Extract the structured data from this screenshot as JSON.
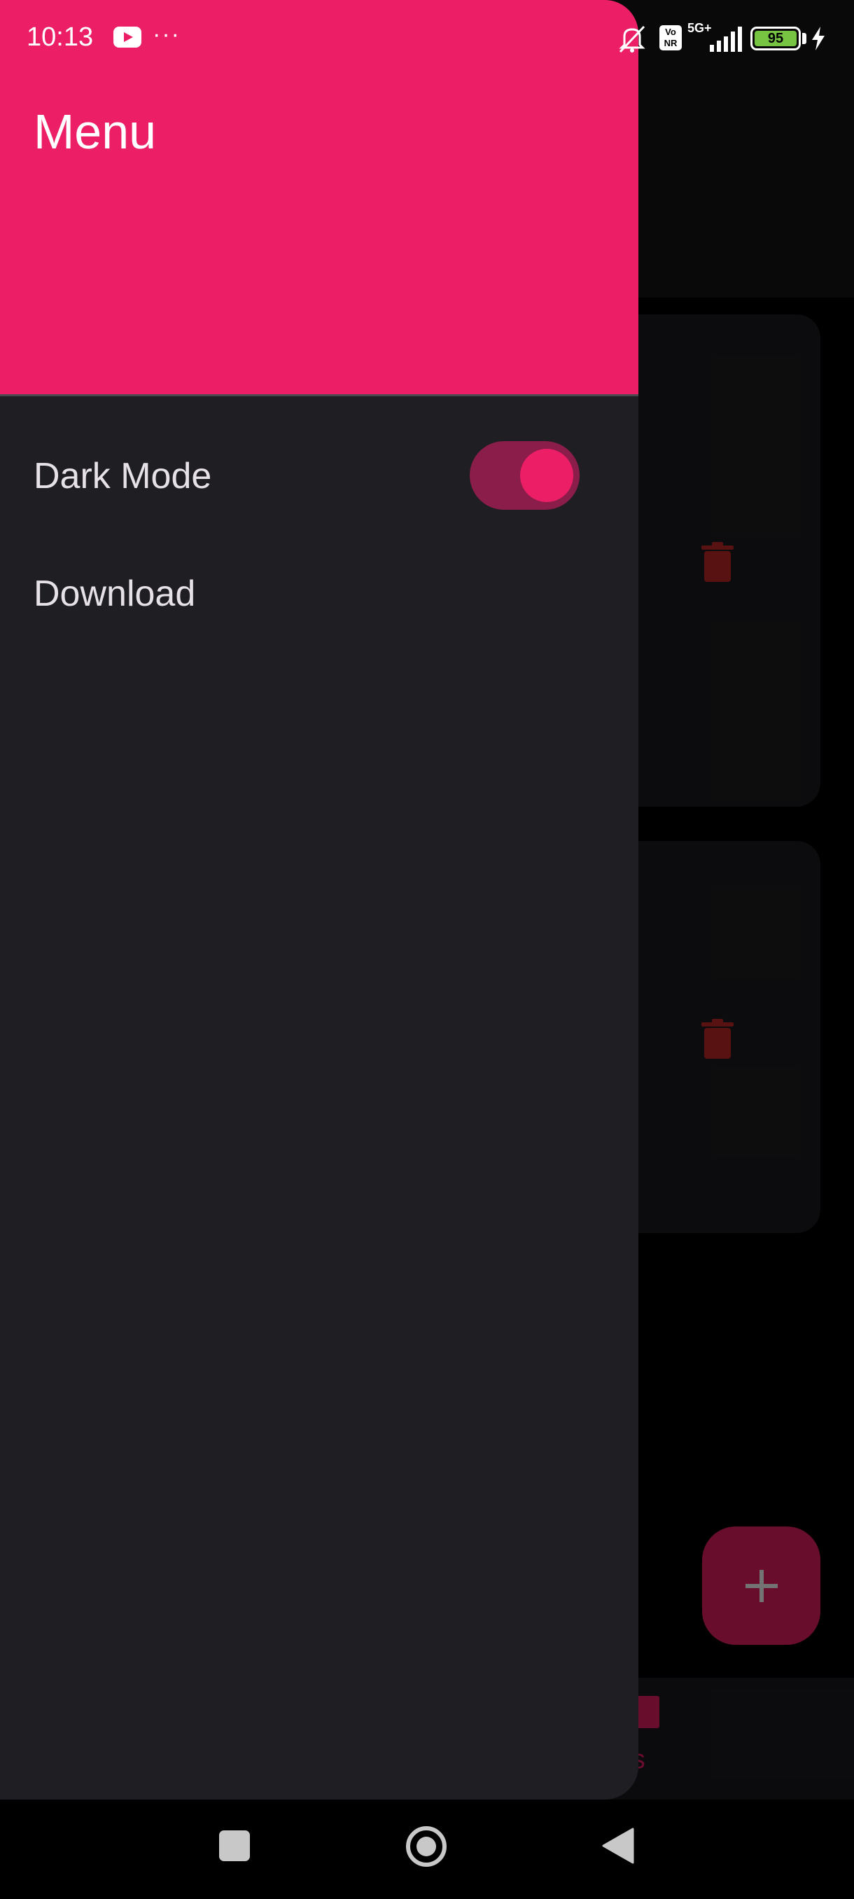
{
  "status_bar": {
    "time": "10:13",
    "more_indicator": "···",
    "volte_label": "Vo NR",
    "network_label": "5G+",
    "battery_level": "95",
    "icons": [
      "youtube-icon",
      "mute-icon",
      "signal-icon",
      "battery-icon",
      "charging-icon"
    ]
  },
  "drawer": {
    "title": "Menu",
    "items": [
      {
        "label": "Dark Mode",
        "type": "toggle",
        "checked": true
      },
      {
        "label": "Download",
        "type": "action"
      }
    ]
  },
  "background_app": {
    "bottom_nav_label": "oms",
    "cards": 2,
    "fab_icon": "plus-icon",
    "card_icon": "trash-icon"
  },
  "nav_bar": {
    "buttons": [
      "recent-apps",
      "home",
      "back"
    ]
  },
  "colors": {
    "accent": "#ec1f66",
    "drawer_bg": "#1f1e23",
    "switch_track": "#8b1d4a",
    "text": "#e6e1e6"
  }
}
